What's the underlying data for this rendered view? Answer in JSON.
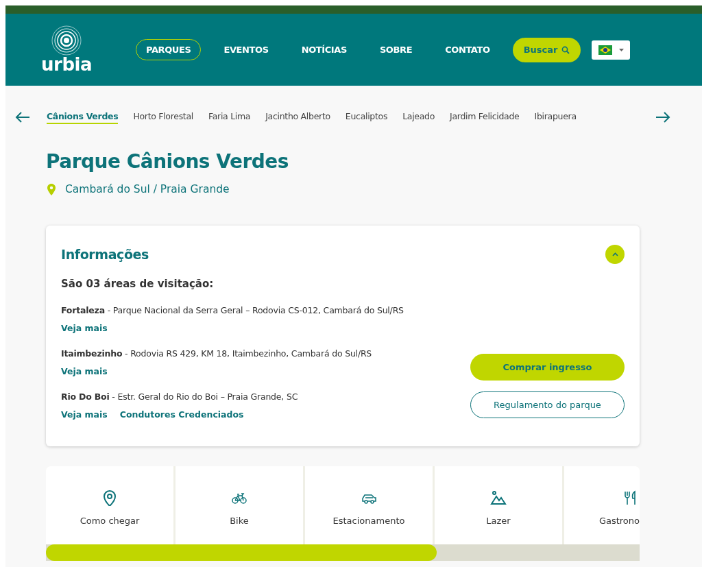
{
  "header": {
    "logo": "urbia",
    "nav": [
      {
        "label": "PARQUES",
        "selected": true
      },
      {
        "label": "EVENTOS",
        "selected": false
      },
      {
        "label": "NOTÍCIAS",
        "selected": false
      },
      {
        "label": "SOBRE",
        "selected": false
      },
      {
        "label": "CONTATO",
        "selected": false
      }
    ],
    "search_button": "Buscar"
  },
  "park_tabs": [
    {
      "label": "Cânions Verdes",
      "selected": true
    },
    {
      "label": "Horto Florestal",
      "selected": false
    },
    {
      "label": "Faria Lima",
      "selected": false
    },
    {
      "label": "Jacintho Alberto",
      "selected": false
    },
    {
      "label": "Eucaliptos",
      "selected": false
    },
    {
      "label": "Lajeado",
      "selected": false
    },
    {
      "label": "Jardim Felicidade",
      "selected": false
    },
    {
      "label": "Ibirapuera",
      "selected": false
    }
  ],
  "title": "Parque Cânions Verdes",
  "location": "Cambará do Sul / Praia Grande",
  "info": {
    "title": "Informações",
    "expanded": true,
    "subtitle": "São 03 áreas de visitação:",
    "areas": [
      {
        "text": "**Fortaleza** - Parque Nacional da Serra Geral – Rodovia CS-012, Cambará do Sul/RS",
        "links": [
          "Veja mais"
        ]
      },
      {
        "text": "**Itaimbezinho** - Rodovia RS 429, KM 18, Itaimbezinho, Cambará do Sul/RS",
        "links": [
          "Veja mais"
        ]
      },
      {
        "text": "**Rio Do Boi** - Estr. Geral do Rio do Boi – Praia Grande, SC",
        "links": [
          "Veja mais",
          "Condutores Credenciados"
        ]
      }
    ],
    "buttons": [
      {
        "label": "Comprar ingresso",
        "kind": "primary"
      },
      {
        "label": "Regulamento do parque",
        "kind": "outline"
      }
    ]
  },
  "features": [
    {
      "label": "Como chegar",
      "kind": "pin"
    },
    {
      "label": "Bike",
      "kind": "bike"
    },
    {
      "label": "Estacionamento",
      "kind": "car"
    },
    {
      "label": "Lazer",
      "kind": "mountain"
    },
    {
      "label": "Gastrono",
      "kind": "food"
    }
  ]
}
